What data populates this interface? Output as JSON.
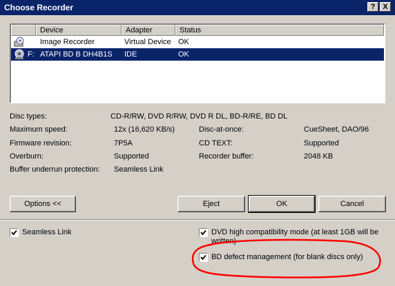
{
  "window": {
    "title": "Choose Recorder",
    "help_label": "?",
    "close_label": "X"
  },
  "devices": {
    "columns": [
      "Device",
      "Adapter",
      "Status"
    ],
    "rows": [
      {
        "letter": "",
        "device": "Image Recorder",
        "adapter": "Virtual Device",
        "status": "OK",
        "selected": false,
        "icon": "image-recorder-icon"
      },
      {
        "letter": "F:",
        "device": "ATAPI  BD  B  DH4B1S",
        "adapter": "IDE",
        "status": "OK",
        "selected": true,
        "icon": "optical-drive-icon"
      }
    ]
  },
  "info": {
    "disc_types_label": "Disc types:",
    "disc_types_value": "CD-R/RW, DVD R/RW, DVD R DL, BD-R/RE, BD DL",
    "max_speed_label": "Maximum speed:",
    "max_speed_value": "12x (16,620 KB/s)",
    "firmware_label": "Firmware revision:",
    "firmware_value": "7P5A",
    "overburn_label": "Overburn:",
    "overburn_value": "Supported",
    "buffer_underrun_label": "Buffer underrun protection:",
    "buffer_underrun_value": "Seamless Link",
    "dao_label": "Disc-at-once:",
    "dao_value": "CueSheet, DAO/96",
    "cdtext_label": "CD TEXT:",
    "cdtext_value": "Supported",
    "recbuf_label": "Recorder buffer:",
    "recbuf_value": "2048 KB"
  },
  "buttons": {
    "options": "Options <<",
    "eject": "Eject",
    "ok": "OK",
    "cancel": "Cancel"
  },
  "options": {
    "seamless_link": {
      "label": "Seamless Link",
      "checked": true
    },
    "dvd_compat": {
      "label_line1": "DVD high compatibility mode (at least 1GB will be",
      "label_line2": "written)",
      "checked": true
    },
    "bd_defect": {
      "label": "BD defect management (for blank discs only)",
      "checked": true
    }
  },
  "annotation_color": "#ff0000"
}
